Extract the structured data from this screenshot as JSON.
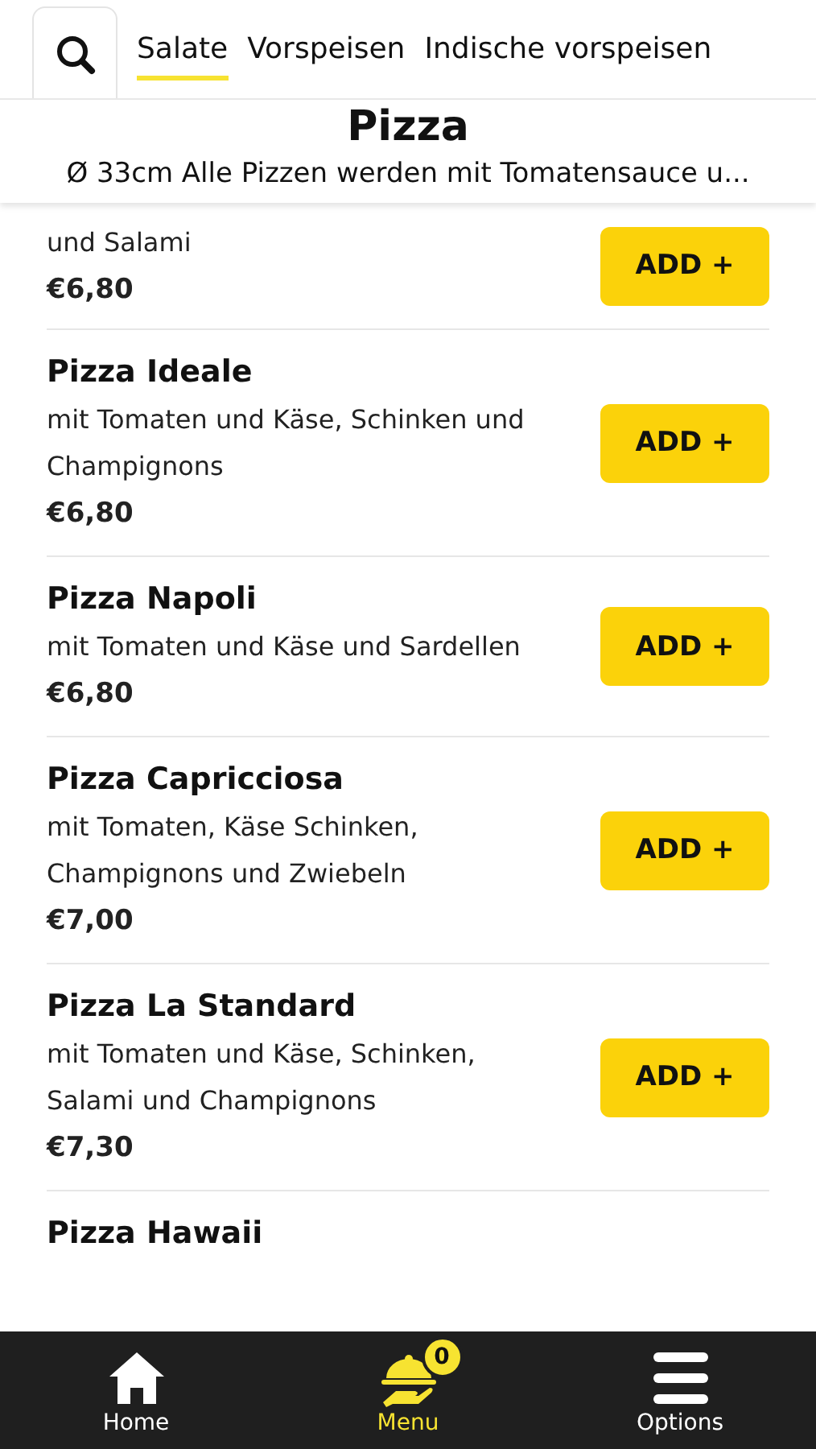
{
  "tabs": [
    {
      "label": "Salate",
      "selected": true
    },
    {
      "label": "Vorspeisen",
      "selected": false
    },
    {
      "label": "Indische vorspeisen",
      "selected": false
    }
  ],
  "category": {
    "title": "Pizza",
    "description": "Ø 33cm Alle Pizzen werden mit Tomatensauce u..."
  },
  "items": [
    {
      "description": "und Salami",
      "price": "€6,80",
      "button": "ADD +"
    },
    {
      "name": "Pizza Ideale",
      "description": "mit Tomaten und Käse, Schinken und Champignons",
      "price": "€6,80",
      "button": "ADD +"
    },
    {
      "name": "Pizza Napoli",
      "description": "mit Tomaten und Käse und Sardellen",
      "price": "€6,80",
      "button": "ADD +"
    },
    {
      "name": "Pizza Capricciosa",
      "description": "mit Tomaten, Käse Schinken, Champignons und Zwiebeln",
      "price": "€7,00",
      "button": "ADD +"
    },
    {
      "name": "Pizza La Standard",
      "description": "mit Tomaten und Käse, Schinken, Salami und Champignons",
      "price": "€7,30",
      "button": "ADD +"
    },
    {
      "name": "Pizza Hawaii"
    }
  ],
  "nav": [
    {
      "label": "Home",
      "kind": "home",
      "selected": false
    },
    {
      "label": "Menu",
      "kind": "menu",
      "selected": true,
      "badge": "0"
    },
    {
      "label": "Options",
      "kind": "options",
      "selected": false
    }
  ]
}
